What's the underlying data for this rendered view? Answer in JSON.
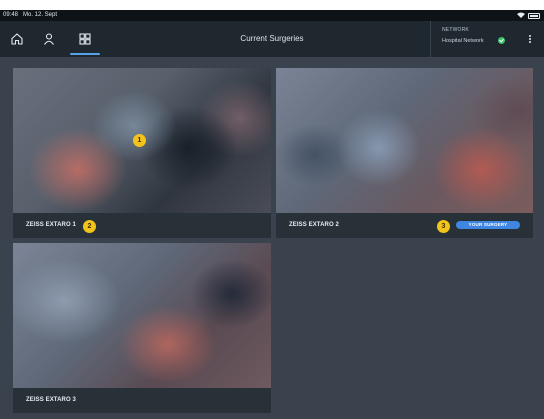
{
  "status_bar": {
    "time": "09:48",
    "date": "Mo. 12. Sept"
  },
  "app_bar": {
    "nav": [
      {
        "name": "home",
        "icon": "home-icon"
      },
      {
        "name": "profile",
        "icon": "person-icon"
      },
      {
        "name": "grid",
        "icon": "grid-view-icon",
        "active": true
      }
    ],
    "title": "Current Surgeries",
    "network": {
      "label": "NETWORK",
      "value": "Hospital Network",
      "status": "connected"
    },
    "more_icon": "more-vertical-icon"
  },
  "surgeries": [
    {
      "name": "ZEISS EXTARO 1"
    },
    {
      "name": "ZEISS EXTARO 2",
      "badge": "YOUR SURGERY"
    },
    {
      "name": "ZEISS EXTARO 3"
    }
  ],
  "markers": [
    "1",
    "2",
    "3"
  ],
  "colors": {
    "accent": "#5aa2e6",
    "badge": "#3f86e2",
    "marker": "#f2c318",
    "ok": "#3cc36b"
  }
}
